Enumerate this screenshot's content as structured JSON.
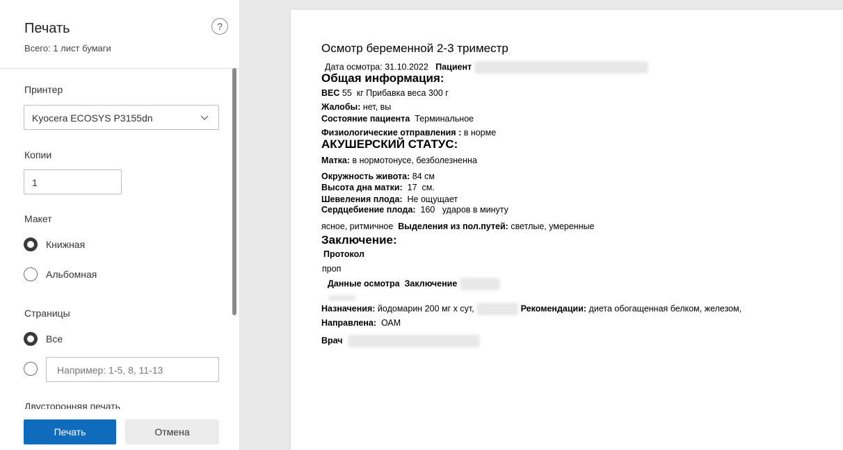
{
  "dialog": {
    "title": "Печать",
    "subtitle": "Всего: 1 лист бумаги",
    "help_label": "?",
    "printer_label": "Принтер",
    "printer_value": "Kyocera ECOSYS P3155dn",
    "copies_label": "Копии",
    "copies_value": "1",
    "layout_label": "Макет",
    "layout_options": [
      "Книжная",
      "Альбомная"
    ],
    "layout_selected": "Книжная",
    "pages_label": "Страницы",
    "pages_all": "Все",
    "pages_placeholder": "Например: 1-5, 8, 11-13",
    "duplex_label": "Двусторонняя печать",
    "print_button": "Печать",
    "cancel_button": "Отмена",
    "accent_color": "#0f6cbd"
  },
  "document": {
    "title": "Осмотр беременной 2-3 триместр",
    "date_label": "Дата осмотра:",
    "date_value": "31.10.2022",
    "patient_label": "Пациент",
    "general_heading": "Общая информация:",
    "weight_label": "ВЕС",
    "weight_value": "55",
    "weight_rest": "кг Прибавка веса 300 г",
    "complaints_label": "Жалобы:",
    "complaints_value": "нет, вы",
    "condition_label": "Состояние пациента",
    "condition_value": "Терминальное",
    "physio_label": "Физиологические отправления :",
    "physio_value": "в норме",
    "obst_heading": "АКУШЕРСКИЙ СТАТУС:",
    "uterus_label": "Матка:",
    "uterus_value": "в нормотонусе, безболезненна",
    "abdomen_label": "Окружность живота:",
    "abdomen_value": "84 см",
    "fundus_label": "Высота дна матки:",
    "fundus_value": "17",
    "fundus_unit": "см.",
    "movement_label": "Шевеления плода:",
    "movement_value": "Не ощущает",
    "heartbeat_label": "Сердцебиение плода:",
    "heartbeat_value": "160",
    "heartbeat_unit": "ударов в минуту",
    "heartbeat_desc": "ясное, ритмичное",
    "discharge_label": "Выделения из пол.путей:",
    "discharge_value": "светлые, умеренные",
    "conclusion_heading": "Заключение:",
    "protocol_label": "Протокол",
    "protocol_value": "проп",
    "exam_data_label": "Данные осмотра",
    "conclusion_label": "Заключение",
    "appointments_label": "Назначения:",
    "appointments_value": "йодомарин 200 мг х сут,",
    "recommendations_label": "Рекомендации:",
    "recommendations_value": "диета обогащенная белком, железом,",
    "referral_label": "Направлена:",
    "referral_value": "ОАМ",
    "doctor_label": "Врач"
  }
}
